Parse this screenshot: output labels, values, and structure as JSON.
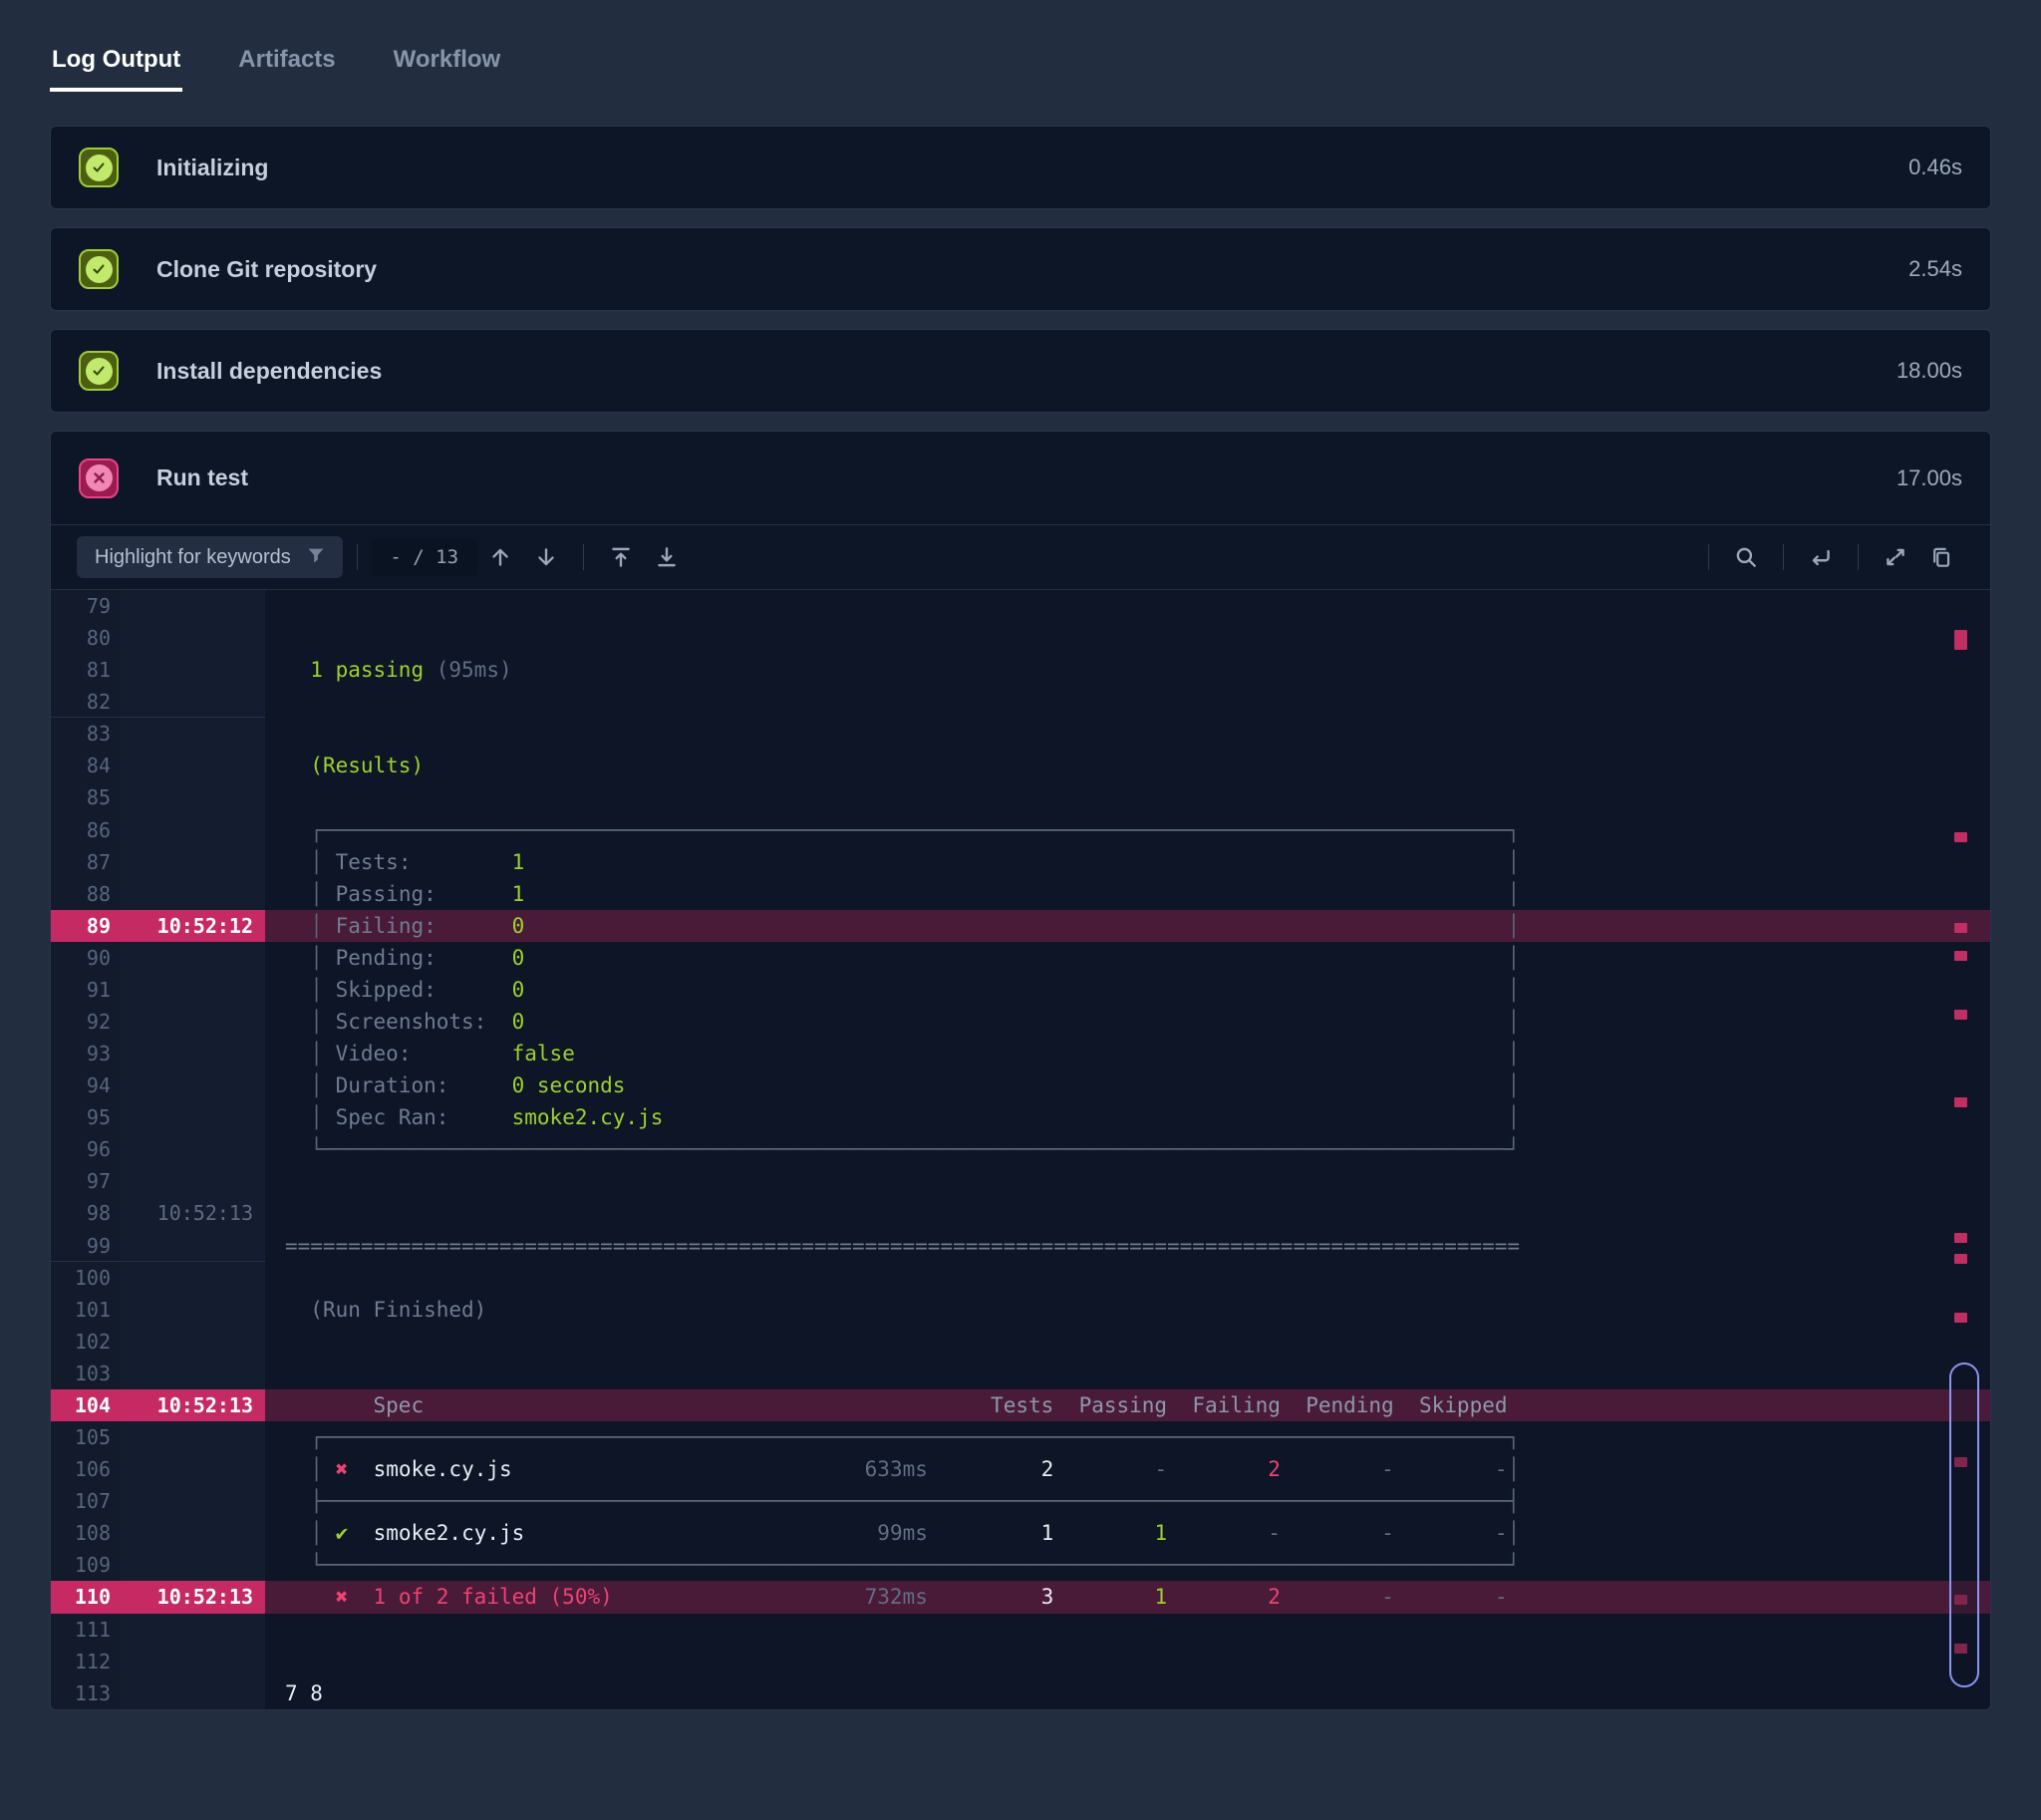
{
  "tabs": [
    {
      "label": "Log Output",
      "active": true
    },
    {
      "label": "Artifacts",
      "active": false
    },
    {
      "label": "Workflow",
      "active": false
    }
  ],
  "steps": [
    {
      "label": "Initializing",
      "duration": "0.46s",
      "status": "passed"
    },
    {
      "label": "Clone Git repository",
      "duration": "2.54s",
      "status": "passed"
    },
    {
      "label": "Install dependencies",
      "duration": "18.00s",
      "status": "passed"
    },
    {
      "label": "Run test",
      "duration": "17.00s",
      "status": "failed"
    }
  ],
  "toolbar": {
    "filter_placeholder": "Highlight for keywords",
    "match_counter": "- / 13",
    "icons": [
      "filter-icon",
      "arrow-up-icon",
      "arrow-down-icon",
      "scroll-to-top-icon",
      "scroll-to-bottom-icon",
      "search-icon",
      "wrap-lines-icon",
      "expand-icon",
      "copy-icon"
    ]
  },
  "colors": {
    "accent_green": "#9ed22c",
    "accent_red": "#ee4371",
    "highlight_gutter": "#c52a63",
    "highlight_row": "#4a1b39",
    "thumb_border": "#8a96f0"
  },
  "log": {
    "lines": [
      {
        "n": "79"
      },
      {
        "n": "80"
      },
      {
        "n": "81",
        "segs": [
          {
            "sp": 2
          },
          {
            "c": "grn",
            "t": "1 passing"
          },
          {
            "sp": 1
          },
          {
            "c": "mut",
            "t": "(95ms)"
          }
        ]
      },
      {
        "n": "82",
        "gsep": true
      },
      {
        "n": "83"
      },
      {
        "n": "84",
        "segs": [
          {
            "sp": 2
          },
          {
            "c": "grn",
            "t": "(Results)"
          }
        ]
      },
      {
        "n": "85"
      },
      {
        "n": "86",
        "segs": [
          {
            "sp": 2
          },
          {
            "c": "dim",
            "t": "┌"
          },
          {
            "c": "dim",
            "t": "─",
            "n": 94
          },
          {
            "c": "dim",
            "t": "┐"
          }
        ]
      },
      {
        "n": "87",
        "segs": [
          {
            "sp": 2
          },
          {
            "c": "dim",
            "t": "│"
          },
          {
            "sp": 1
          },
          {
            "c": "txt",
            "t": "Tests:"
          },
          {
            "sp": 8
          },
          {
            "c": "grn",
            "t": "1"
          },
          {
            "sp": 78
          },
          {
            "c": "dim",
            "t": "│"
          }
        ]
      },
      {
        "n": "88",
        "segs": [
          {
            "sp": 2
          },
          {
            "c": "dim",
            "t": "│"
          },
          {
            "sp": 1
          },
          {
            "c": "txt",
            "t": "Passing:"
          },
          {
            "sp": 6
          },
          {
            "c": "grn",
            "t": "1"
          },
          {
            "sp": 78
          },
          {
            "c": "dim",
            "t": "│"
          }
        ]
      },
      {
        "n": "89",
        "ts": "10:52:12",
        "hl": true,
        "segs": [
          {
            "sp": 2
          },
          {
            "c": "dim",
            "t": "│"
          },
          {
            "sp": 1
          },
          {
            "c": "txt",
            "t": "Failing:"
          },
          {
            "sp": 6
          },
          {
            "c": "grn",
            "t": "0"
          },
          {
            "sp": 78
          },
          {
            "c": "dim",
            "t": "│"
          }
        ]
      },
      {
        "n": "90",
        "segs": [
          {
            "sp": 2
          },
          {
            "c": "dim",
            "t": "│"
          },
          {
            "sp": 1
          },
          {
            "c": "txt",
            "t": "Pending:"
          },
          {
            "sp": 6
          },
          {
            "c": "grn",
            "t": "0"
          },
          {
            "sp": 78
          },
          {
            "c": "dim",
            "t": "│"
          }
        ]
      },
      {
        "n": "91",
        "segs": [
          {
            "sp": 2
          },
          {
            "c": "dim",
            "t": "│"
          },
          {
            "sp": 1
          },
          {
            "c": "txt",
            "t": "Skipped:"
          },
          {
            "sp": 6
          },
          {
            "c": "grn",
            "t": "0"
          },
          {
            "sp": 78
          },
          {
            "c": "dim",
            "t": "│"
          }
        ]
      },
      {
        "n": "92",
        "segs": [
          {
            "sp": 2
          },
          {
            "c": "dim",
            "t": "│"
          },
          {
            "sp": 1
          },
          {
            "c": "txt",
            "t": "Screenshots:"
          },
          {
            "sp": 2
          },
          {
            "c": "grn",
            "t": "0"
          },
          {
            "sp": 78
          },
          {
            "c": "dim",
            "t": "│"
          }
        ]
      },
      {
        "n": "93",
        "segs": [
          {
            "sp": 2
          },
          {
            "c": "dim",
            "t": "│"
          },
          {
            "sp": 1
          },
          {
            "c": "txt",
            "t": "Video:"
          },
          {
            "sp": 8
          },
          {
            "c": "grn",
            "t": "false"
          },
          {
            "sp": 74
          },
          {
            "c": "dim",
            "t": "│"
          }
        ]
      },
      {
        "n": "94",
        "segs": [
          {
            "sp": 2
          },
          {
            "c": "dim",
            "t": "│"
          },
          {
            "sp": 1
          },
          {
            "c": "txt",
            "t": "Duration:"
          },
          {
            "sp": 5
          },
          {
            "c": "grn",
            "t": "0 seconds"
          },
          {
            "sp": 70
          },
          {
            "c": "dim",
            "t": "│"
          }
        ]
      },
      {
        "n": "95",
        "segs": [
          {
            "sp": 2
          },
          {
            "c": "dim",
            "t": "│"
          },
          {
            "sp": 1
          },
          {
            "c": "txt",
            "t": "Spec Ran:"
          },
          {
            "sp": 5
          },
          {
            "c": "grn",
            "t": "smoke2.cy.js"
          },
          {
            "sp": 67
          },
          {
            "c": "dim",
            "t": "│"
          }
        ]
      },
      {
        "n": "96",
        "segs": [
          {
            "sp": 2
          },
          {
            "c": "dim",
            "t": "└"
          },
          {
            "c": "dim",
            "t": "─",
            "n": 94
          },
          {
            "c": "dim",
            "t": "┘"
          }
        ]
      },
      {
        "n": "97"
      },
      {
        "n": "98",
        "ts": "10:52:13"
      },
      {
        "n": "99",
        "gsep": true,
        "segs": [
          {
            "c": "txt",
            "t": "=",
            "n": 98
          }
        ]
      },
      {
        "n": "100"
      },
      {
        "n": "101",
        "segs": [
          {
            "sp": 2
          },
          {
            "c": "txt",
            "t": "(Run Finished)"
          }
        ]
      },
      {
        "n": "102"
      },
      {
        "n": "103"
      },
      {
        "n": "104",
        "ts": "10:52:13",
        "hl": true,
        "segs": [
          {
            "sp": 7
          },
          {
            "c": "hdr",
            "t": "Spec"
          },
          {
            "sp": 45
          },
          {
            "c": "hdr",
            "t": "Tests"
          },
          {
            "sp": 2
          },
          {
            "c": "hdr",
            "t": "Passing"
          },
          {
            "sp": 2
          },
          {
            "c": "hdr",
            "t": "Failing"
          },
          {
            "sp": 2
          },
          {
            "c": "hdr",
            "t": "Pending"
          },
          {
            "sp": 2
          },
          {
            "c": "hdr",
            "t": "Skipped"
          }
        ]
      },
      {
        "n": "105",
        "segs": [
          {
            "sp": 2
          },
          {
            "c": "dim",
            "t": "┌"
          },
          {
            "c": "dim",
            "t": "─",
            "n": 94
          },
          {
            "c": "dim",
            "t": "┐"
          }
        ]
      },
      {
        "n": "106",
        "segs": [
          {
            "sp": 2
          },
          {
            "c": "dim",
            "t": "│"
          },
          {
            "sp": 1
          },
          {
            "c": "red",
            "t": "✖"
          },
          {
            "sp": 2
          },
          {
            "c": "wht",
            "t": "smoke.cy.js"
          },
          {
            "sp": 28
          },
          {
            "c": "mut",
            "t": "633ms"
          },
          {
            "sp": 9
          },
          {
            "c": "wht",
            "t": "2"
          },
          {
            "sp": 8
          },
          {
            "c": "mut",
            "t": "-"
          },
          {
            "sp": 8
          },
          {
            "c": "red",
            "t": "2"
          },
          {
            "sp": 8
          },
          {
            "c": "mut",
            "t": "-"
          },
          {
            "sp": 8
          },
          {
            "c": "mut",
            "t": "-"
          },
          {
            "c": "dim",
            "t": "│"
          }
        ]
      },
      {
        "n": "107",
        "segs": [
          {
            "sp": 2
          },
          {
            "c": "dim",
            "t": "├"
          },
          {
            "c": "dim",
            "t": "─",
            "n": 94
          },
          {
            "c": "dim",
            "t": "┤"
          }
        ]
      },
      {
        "n": "108",
        "segs": [
          {
            "sp": 2
          },
          {
            "c": "dim",
            "t": "│"
          },
          {
            "sp": 1
          },
          {
            "c": "grn",
            "t": "✔"
          },
          {
            "sp": 2
          },
          {
            "c": "wht",
            "t": "smoke2.cy.js"
          },
          {
            "sp": 28
          },
          {
            "c": "mut",
            "t": "99ms"
          },
          {
            "sp": 9
          },
          {
            "c": "wht",
            "t": "1"
          },
          {
            "sp": 8
          },
          {
            "c": "grn",
            "t": "1"
          },
          {
            "sp": 8
          },
          {
            "c": "mut",
            "t": "-"
          },
          {
            "sp": 8
          },
          {
            "c": "mut",
            "t": "-"
          },
          {
            "sp": 8
          },
          {
            "c": "mut",
            "t": "-"
          },
          {
            "c": "dim",
            "t": "│"
          }
        ]
      },
      {
        "n": "109",
        "segs": [
          {
            "sp": 2
          },
          {
            "c": "dim",
            "t": "└"
          },
          {
            "c": "dim",
            "t": "─",
            "n": 94
          },
          {
            "c": "dim",
            "t": "┘"
          }
        ]
      },
      {
        "n": "110",
        "ts": "10:52:13",
        "hl": true,
        "segs": [
          {
            "sp": 4
          },
          {
            "c": "red",
            "t": "✖"
          },
          {
            "sp": 2
          },
          {
            "c": "red",
            "t": "1 of 2 failed (50%)"
          },
          {
            "sp": 20
          },
          {
            "c": "mut",
            "t": "732ms"
          },
          {
            "sp": 9
          },
          {
            "c": "wht",
            "t": "3"
          },
          {
            "sp": 8
          },
          {
            "c": "grn",
            "t": "1"
          },
          {
            "sp": 8
          },
          {
            "c": "red",
            "t": "2"
          },
          {
            "sp": 8
          },
          {
            "c": "mut",
            "t": "-"
          },
          {
            "sp": 8
          },
          {
            "c": "mut",
            "t": "-"
          }
        ]
      },
      {
        "n": "111"
      },
      {
        "n": "112"
      },
      {
        "n": "113",
        "segs": [
          {
            "c": "wht",
            "t": "7 8"
          }
        ]
      }
    ]
  },
  "minimap": {
    "markers": [
      {
        "f": 0.036,
        "h": 20
      },
      {
        "f": 0.216
      },
      {
        "f": 0.297
      },
      {
        "f": 0.322
      },
      {
        "f": 0.375
      },
      {
        "f": 0.453
      },
      {
        "f": 0.574
      },
      {
        "f": 0.593
      },
      {
        "f": 0.646
      },
      {
        "f": 0.775
      },
      {
        "f": 0.898
      },
      {
        "f": 0.941
      }
    ],
    "thumb": {
      "top": 0.69,
      "height": 0.29
    }
  }
}
